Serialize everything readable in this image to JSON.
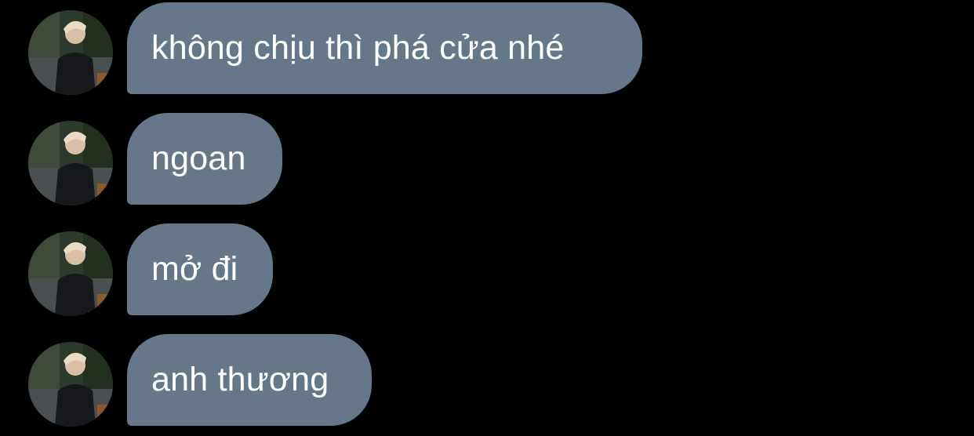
{
  "conversation": {
    "messages": [
      {
        "text": "không chịu thì phá cửa nhé",
        "sender_avatar": "user-avatar"
      },
      {
        "text": "ngoan",
        "sender_avatar": "user-avatar"
      },
      {
        "text": "mở đi",
        "sender_avatar": "user-avatar"
      },
      {
        "text": "anh thương",
        "sender_avatar": "user-avatar"
      }
    ]
  },
  "colors": {
    "background": "#000000",
    "bubble": "#67778a",
    "text": "#ffffff"
  }
}
